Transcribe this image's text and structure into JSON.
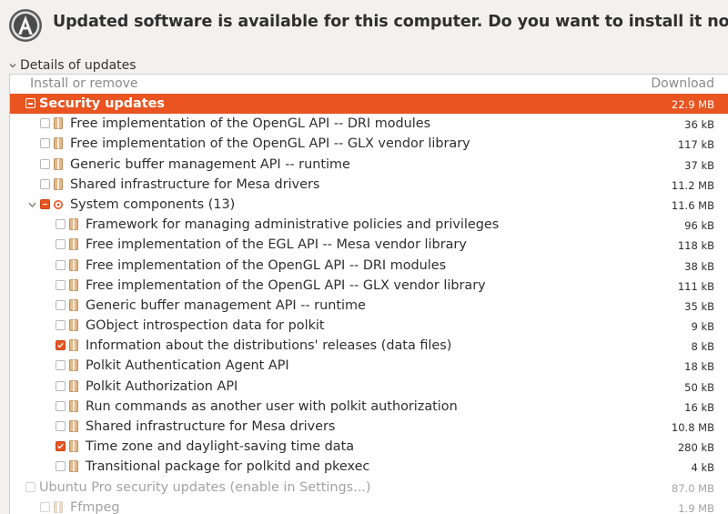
{
  "header": {
    "title": "Updated software is available for this computer. Do you want to install it now?",
    "icon": "software-updater-icon"
  },
  "details": {
    "label": "Details of updates",
    "expanded": true
  },
  "columns": {
    "install_label": "Install or remove",
    "download_label": "Download"
  },
  "colors": {
    "accent": "#e95420",
    "row_text": "#2e2e2e",
    "disabled_text": "#a3a3a3"
  },
  "rows": [
    {
      "label": "Security updates",
      "size": "22.9 MB",
      "level": 0,
      "kind": "group",
      "check": "mixed",
      "selected": true
    },
    {
      "label": "Free implementation of the OpenGL API -- DRI modules",
      "size": "36 kB",
      "level": 1,
      "kind": "pkg",
      "check": "none"
    },
    {
      "label": "Free implementation of the OpenGL API -- GLX vendor library",
      "size": "117 kB",
      "level": 1,
      "kind": "pkg",
      "check": "none"
    },
    {
      "label": "Generic buffer management API -- runtime",
      "size": "37 kB",
      "level": 1,
      "kind": "pkg",
      "check": "none"
    },
    {
      "label": "Shared infrastructure for Mesa drivers",
      "size": "11.2 MB",
      "level": 1,
      "kind": "pkg",
      "check": "none"
    },
    {
      "label": "System components (13)",
      "size": "11.6 MB",
      "level": 1,
      "kind": "subgroup",
      "check": "mixed",
      "expanded": true
    },
    {
      "label": "Framework for managing administrative policies and privileges",
      "size": "96 kB",
      "level": 2,
      "kind": "pkg",
      "check": "none"
    },
    {
      "label": "Free implementation of the EGL API -- Mesa vendor library",
      "size": "118 kB",
      "level": 2,
      "kind": "pkg",
      "check": "none"
    },
    {
      "label": "Free implementation of the OpenGL API -- DRI modules",
      "size": "38 kB",
      "level": 2,
      "kind": "pkg",
      "check": "none"
    },
    {
      "label": "Free implementation of the OpenGL API -- GLX vendor library",
      "size": "111 kB",
      "level": 2,
      "kind": "pkg",
      "check": "none"
    },
    {
      "label": "Generic buffer management API -- runtime",
      "size": "35 kB",
      "level": 2,
      "kind": "pkg",
      "check": "none"
    },
    {
      "label": "GObject introspection data for polkit",
      "size": "9 kB",
      "level": 2,
      "kind": "pkg",
      "check": "none"
    },
    {
      "label": "Information about the distributions' releases (data files)",
      "size": "8 kB",
      "level": 2,
      "kind": "pkg",
      "check": "checked"
    },
    {
      "label": "Polkit Authentication Agent API",
      "size": "18 kB",
      "level": 2,
      "kind": "pkg",
      "check": "none"
    },
    {
      "label": "Polkit Authorization API",
      "size": "50 kB",
      "level": 2,
      "kind": "pkg",
      "check": "none"
    },
    {
      "label": "Run commands as another user with polkit authorization",
      "size": "16 kB",
      "level": 2,
      "kind": "pkg",
      "check": "none"
    },
    {
      "label": "Shared infrastructure for Mesa drivers",
      "size": "10.8 MB",
      "level": 2,
      "kind": "pkg",
      "check": "none"
    },
    {
      "label": "Time zone and daylight-saving time data",
      "size": "280 kB",
      "level": 2,
      "kind": "pkg",
      "check": "checked"
    },
    {
      "label": "Transitional package for polkitd and pkexec",
      "size": "4 kB",
      "level": 2,
      "kind": "pkg",
      "check": "none"
    },
    {
      "label": "Ubuntu Pro security updates (enable in Settings...)",
      "size": "87.0 MB",
      "level": 0,
      "kind": "group",
      "check": "none",
      "disabled": true
    },
    {
      "label": "Ffmpeg",
      "size": "1.9 MB",
      "level": 1,
      "kind": "pkg",
      "check": "none",
      "disabled": true
    }
  ]
}
